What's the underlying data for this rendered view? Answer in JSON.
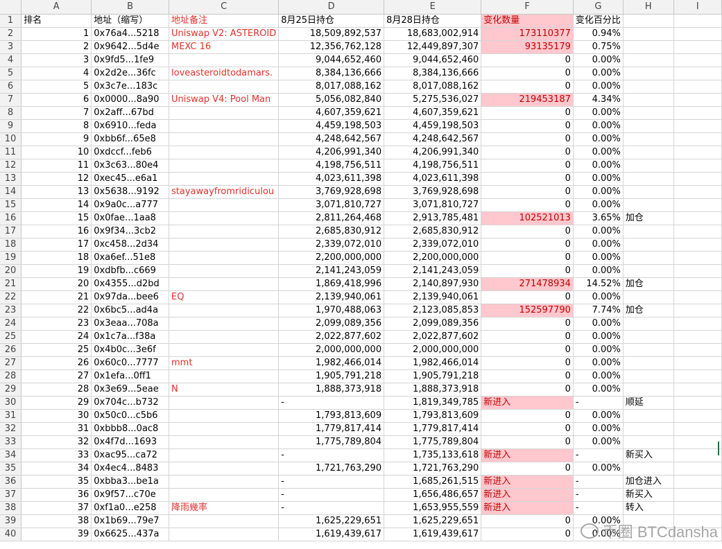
{
  "columns": [
    "",
    "A",
    "B",
    "C",
    "D",
    "E",
    "F",
    "G",
    "H",
    "I"
  ],
  "header_row": {
    "row": "1",
    "cells": [
      "排名",
      "地址（缩写）",
      "地址备注",
      "8月25日持仓",
      "8月28日持仓",
      "变化数量",
      "变化百分比",
      "",
      ""
    ]
  },
  "rows": [
    {
      "row": "2",
      "rank": "1",
      "addr": "0x76a4...5218",
      "note": "Uniswap V2: ASTEROID",
      "d": "18,509,892,537",
      "e": "18,683,002,914",
      "f": "173110377",
      "g": "0.94%",
      "h": ""
    },
    {
      "row": "3",
      "rank": "2",
      "addr": "0x9642...5d4e",
      "note": "MEXC 16",
      "d": "12,356,762,128",
      "e": "12,449,897,307",
      "f": "93135179",
      "g": "0.75%",
      "h": ""
    },
    {
      "row": "4",
      "rank": "3",
      "addr": "0x9fd5...1fe9",
      "note": "",
      "d": "9,044,652,460",
      "e": "9,044,652,460",
      "f": "0",
      "g": "0.00%",
      "h": ""
    },
    {
      "row": "5",
      "rank": "4",
      "addr": "0x2d2e...36fc",
      "note": "loveasteroidtodamars.",
      "d": "8,384,136,666",
      "e": "8,384,136,666",
      "f": "0",
      "g": "0.00%",
      "h": ""
    },
    {
      "row": "6",
      "rank": "5",
      "addr": "0x3c7e...183c",
      "note": "",
      "d": "8,017,088,162",
      "e": "8,017,088,162",
      "f": "0",
      "g": "0.00%",
      "h": ""
    },
    {
      "row": "7",
      "rank": "6",
      "addr": "0x0000...8a90",
      "note": "Uniswap V4: Pool Man",
      "d": "5,056,082,840",
      "e": "5,275,536,027",
      "f": "219453187",
      "g": "4.34%",
      "h": ""
    },
    {
      "row": "8",
      "rank": "7",
      "addr": "0x2aff...67bd",
      "note": "",
      "d": "4,607,359,621",
      "e": "4,607,359,621",
      "f": "0",
      "g": "0.00%",
      "h": ""
    },
    {
      "row": "9",
      "rank": "8",
      "addr": "0x6910...feda",
      "note": "",
      "d": "4,459,198,503",
      "e": "4,459,198,503",
      "f": "0",
      "g": "0.00%",
      "h": ""
    },
    {
      "row": "10",
      "rank": "9",
      "addr": "0xbb6f...65e8",
      "note": "",
      "d": "4,248,642,567",
      "e": "4,248,642,567",
      "f": "0",
      "g": "0.00%",
      "h": ""
    },
    {
      "row": "11",
      "rank": "10",
      "addr": "0xdccf...feb6",
      "note": "",
      "d": "4,206,991,340",
      "e": "4,206,991,340",
      "f": "0",
      "g": "0.00%",
      "h": ""
    },
    {
      "row": "12",
      "rank": "11",
      "addr": "0x3c63...80e4",
      "note": "",
      "d": "4,198,756,511",
      "e": "4,198,756,511",
      "f": "0",
      "g": "0.00%",
      "h": ""
    },
    {
      "row": "13",
      "rank": "12",
      "addr": "0xec45...e6a1",
      "note": "",
      "d": "4,023,611,398",
      "e": "4,023,611,398",
      "f": "0",
      "g": "0.00%",
      "h": ""
    },
    {
      "row": "14",
      "rank": "13",
      "addr": "0x5638...9192",
      "note": "stayawayfromridiculou",
      "d": "3,769,928,698",
      "e": "3,769,928,698",
      "f": "0",
      "g": "0.00%",
      "h": ""
    },
    {
      "row": "15",
      "rank": "14",
      "addr": "0x9a0c...a777",
      "note": "",
      "d": "3,071,810,727",
      "e": "3,071,810,727",
      "f": "0",
      "g": "0.00%",
      "h": ""
    },
    {
      "row": "16",
      "rank": "15",
      "addr": "0x0fae...1aa8",
      "note": "",
      "d": "2,811,264,468",
      "e": "2,913,785,481",
      "f": "102521013",
      "g": "3.65%",
      "h": "加仓"
    },
    {
      "row": "17",
      "rank": "16",
      "addr": "0x9f34...3cb2",
      "note": "",
      "d": "2,685,830,912",
      "e": "2,685,830,912",
      "f": "0",
      "g": "0.00%",
      "h": ""
    },
    {
      "row": "18",
      "rank": "17",
      "addr": "0xc458...2d34",
      "note": "",
      "d": "2,339,072,010",
      "e": "2,339,072,010",
      "f": "0",
      "g": "0.00%",
      "h": ""
    },
    {
      "row": "19",
      "rank": "18",
      "addr": "0xa6ef...51e8",
      "note": "",
      "d": "2,200,000,000",
      "e": "2,200,000,000",
      "f": "0",
      "g": "0.00%",
      "h": ""
    },
    {
      "row": "20",
      "rank": "19",
      "addr": "0xdbfb...c669",
      "note": "",
      "d": "2,141,243,059",
      "e": "2,141,243,059",
      "f": "0",
      "g": "0.00%",
      "h": ""
    },
    {
      "row": "21",
      "rank": "20",
      "addr": "0x4355...d2bd",
      "note": "",
      "d": "1,869,418,996",
      "e": "2,140,897,930",
      "f": "271478934",
      "g": "14.52%",
      "h": "加仓"
    },
    {
      "row": "22",
      "rank": "21",
      "addr": "0x97da...bee6",
      "note": "EQ",
      "d": "2,139,940,061",
      "e": "2,139,940,061",
      "f": "0",
      "g": "0.00%",
      "h": ""
    },
    {
      "row": "23",
      "rank": "22",
      "addr": "0x6bc5...ad4a",
      "note": "",
      "d": "1,970,488,063",
      "e": "2,123,085,853",
      "f": "152597790",
      "g": "7.74%",
      "h": "加仓"
    },
    {
      "row": "24",
      "rank": "23",
      "addr": "0x3eaa...708a",
      "note": "",
      "d": "2,099,089,356",
      "e": "2,099,089,356",
      "f": "0",
      "g": "0.00%",
      "h": ""
    },
    {
      "row": "25",
      "rank": "24",
      "addr": "0x1c7a...f38a",
      "note": "",
      "d": "2,022,877,602",
      "e": "2,022,877,602",
      "f": "0",
      "g": "0.00%",
      "h": ""
    },
    {
      "row": "26",
      "rank": "25",
      "addr": "0x4b0c...3e6f",
      "note": "",
      "d": "2,000,000,000",
      "e": "2,000,000,000",
      "f": "0",
      "g": "0.00%",
      "h": ""
    },
    {
      "row": "27",
      "rank": "26",
      "addr": "0x60c0...7777",
      "note": "mmt",
      "d": "1,982,466,014",
      "e": "1,982,466,014",
      "f": "0",
      "g": "0.00%",
      "h": ""
    },
    {
      "row": "28",
      "rank": "27",
      "addr": "0x1efa...0ff1",
      "note": "",
      "d": "1,905,791,218",
      "e": "1,905,791,218",
      "f": "0",
      "g": "0.00%",
      "h": ""
    },
    {
      "row": "29",
      "rank": "28",
      "addr": "0x3e69...5eae",
      "note": "N",
      "d": "1,888,373,918",
      "e": "1,888,373,918",
      "f": "0",
      "g": "0.00%",
      "h": ""
    },
    {
      "row": "30",
      "rank": "29",
      "addr": "0x704c...b732",
      "note": "",
      "d": "-",
      "e": "1,819,349,785",
      "f": "新进入",
      "g": "-",
      "h": "顺延"
    },
    {
      "row": "31",
      "rank": "30",
      "addr": "0x50c0...c5b6",
      "note": "",
      "d": "1,793,813,609",
      "e": "1,793,813,609",
      "f": "0",
      "g": "0.00%",
      "h": ""
    },
    {
      "row": "32",
      "rank": "31",
      "addr": "0xbbb8...0ac8",
      "note": "",
      "d": "1,779,817,414",
      "e": "1,779,817,414",
      "f": "0",
      "g": "0.00%",
      "h": ""
    },
    {
      "row": "33",
      "rank": "32",
      "addr": "0x4f7d...1693",
      "note": "",
      "d": "1,775,789,804",
      "e": "1,775,789,804",
      "f": "0",
      "g": "0.00%",
      "h": ""
    },
    {
      "row": "34",
      "rank": "33",
      "addr": "0xac95...ca72",
      "note": "",
      "d": "-",
      "e": "1,735,133,618",
      "f": "新进入",
      "g": "-",
      "h": "新买入"
    },
    {
      "row": "35",
      "rank": "34",
      "addr": "0x4ec4...8483",
      "note": "",
      "d": "1,721,763,290",
      "e": "1,721,763,290",
      "f": "0",
      "g": "0.00%",
      "h": ""
    },
    {
      "row": "36",
      "rank": "35",
      "addr": "0xbba3...be1a",
      "note": "",
      "d": "-",
      "e": "1,685,261,515",
      "f": "新进入",
      "g": "-",
      "h": "加仓进入"
    },
    {
      "row": "37",
      "rank": "36",
      "addr": "0x9f57...c70e",
      "note": "",
      "d": "-",
      "e": "1,656,486,657",
      "f": "新进入",
      "g": "-",
      "h": "新买入"
    },
    {
      "row": "38",
      "rank": "37",
      "addr": "0xf1a0...e258",
      "note": "降雨幾率",
      "d": "-",
      "e": "1,653,955,559",
      "f": "新进入",
      "g": "-",
      "h": "转入"
    },
    {
      "row": "39",
      "rank": "38",
      "addr": "0x1b69...79e7",
      "note": "",
      "d": "1,625,229,651",
      "e": "1,625,229,651",
      "f": "0",
      "g": "0.00%",
      "h": ""
    },
    {
      "row": "40",
      "rank": "39",
      "addr": "0x6625...437a",
      "note": "",
      "d": "1,619,439,617",
      "e": "1,619,439,617",
      "f": "0",
      "g": "0.00%",
      "h": ""
    }
  ],
  "watermark": "币圈 BTCdansha",
  "colors": {
    "pink_fill": "#ffc7ce",
    "red_text": "#e0312b",
    "header_bg": "#f2f2f2",
    "grid": "#d4d4d4"
  }
}
